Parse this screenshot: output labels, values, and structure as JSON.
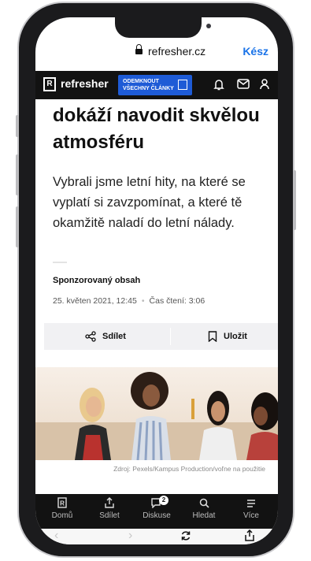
{
  "browser": {
    "url": "refresher.cz",
    "done_label": "Kész"
  },
  "header": {
    "logo_mark": "R",
    "logo_text": "refresher",
    "unlock_line1": "ODEMKNOUT",
    "unlock_line2": "VŠECHNY ČLÁNKY"
  },
  "article": {
    "headline": "dokáží navodit skvělou atmosféru",
    "lead": "Vybrali jsme letní hity, na které se vyplatí si zavzpomínat, a které tě okamžitě naladí do letní nálady.",
    "sponsored": "Sponzorovaný obsah",
    "date": "25. květen 2021, 12:45",
    "read_time": "Čas čtení: 3:06",
    "share_label": "Sdílet",
    "save_label": "Uložit",
    "photo_caption": "Zdroj: Pexels/Kampus Production/voľne na použitie"
  },
  "tabs": [
    {
      "label": "Domů",
      "icon": "home-icon"
    },
    {
      "label": "Sdílet",
      "icon": "share-icon"
    },
    {
      "label": "Diskuse",
      "icon": "comment-icon",
      "badge": "2"
    },
    {
      "label": "Hledat",
      "icon": "search-icon"
    },
    {
      "label": "Více",
      "icon": "menu-icon"
    }
  ],
  "colors": {
    "accent": "#1e5bd6",
    "nav_bg": "#121212",
    "link": "#1a73e8"
  }
}
